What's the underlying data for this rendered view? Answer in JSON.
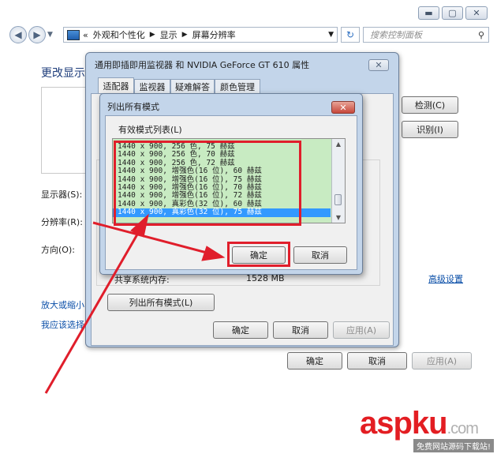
{
  "main_window": {
    "address_path": [
      "外观和个性化",
      "显示",
      "屏幕分辨率"
    ],
    "search_placeholder": "搜索控制面板",
    "heading": "更改显示",
    "detect_button": "检测(C)",
    "identify_button": "识别(I)",
    "display_label": "显示器(S):",
    "resolution_label": "分辨率(R):",
    "orientation_label": "方向(O):",
    "advanced_link": "高级设置",
    "enlarge_link": "放大或缩小",
    "choose_link": "我应该选择",
    "ok_button": "确定",
    "cancel_button": "取消",
    "apply_button": "应用(A)"
  },
  "properties_dialog": {
    "title": "通用即插即用监视器 和 NVIDIA GeForce GT 610 属性",
    "tabs": [
      "适配器",
      "监视器",
      "疑难解答",
      "颜色管理"
    ],
    "shared_memory_label": "共享系统内存:",
    "shared_memory_value": "1528 MB",
    "list_all_modes_button": "列出所有模式(L)",
    "ok_button": "确定",
    "cancel_button": "取消",
    "apply_button": "应用(A)"
  },
  "modes_dialog": {
    "title": "列出所有模式",
    "list_label": "有效模式列表(L)",
    "modes": [
      "1440 x 900, 256 色, 75 赫兹",
      "1440 x 900, 256 色, 70 赫兹",
      "1440 x 900, 256 色, 72 赫兹",
      "1440 x 900, 增强色(16 位), 60 赫兹",
      "1440 x 900, 增强色(16 位), 75 赫兹",
      "1440 x 900, 增强色(16 位), 70 赫兹",
      "1440 x 900, 增强色(16 位), 72 赫兹",
      "1440 x 900, 真彩色(32 位), 60 赫兹",
      "1440 x 900, 真彩色(32 位), 75 赫兹"
    ],
    "selected_index": 8,
    "ok_button": "确定",
    "cancel_button": "取消"
  },
  "watermark": {
    "brand": "aspku",
    "suffix": ".com",
    "tagline": "免费网站源码下载站!"
  },
  "colors": {
    "highlight": "#e01e2b",
    "selection": "#3399ff",
    "list_bg": "#c8ebc2",
    "link": "#0b4fa8"
  }
}
